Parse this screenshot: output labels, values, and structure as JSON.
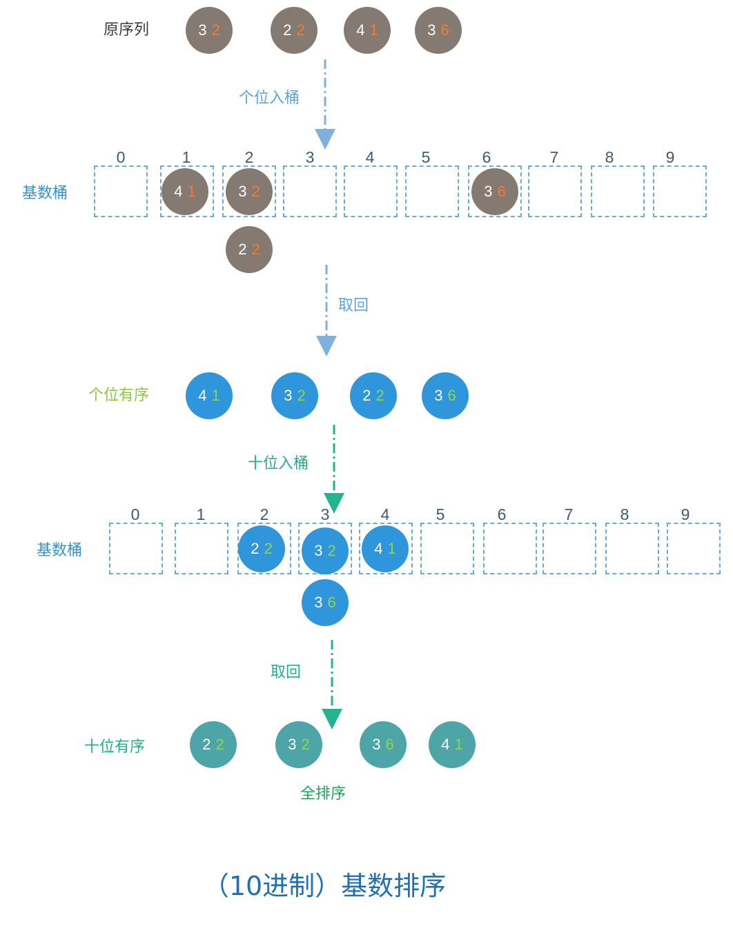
{
  "labels": {
    "original": "原序列",
    "ones_into_bucket": "个位入桶",
    "bucket1": "基数桶",
    "take_back1": "取回",
    "ones_sorted": "个位有序",
    "tens_into_bucket": "十位入桶",
    "bucket2": "基数桶",
    "take_back2": "取回",
    "tens_sorted": "十位有序",
    "fully_sorted": "全排序"
  },
  "title": "（10进制）基数排序",
  "bucket_indices": [
    "0",
    "1",
    "2",
    "3",
    "4",
    "5",
    "6",
    "7",
    "8",
    "9"
  ],
  "original_sequence": [
    {
      "tens": "3",
      "ones": "2"
    },
    {
      "tens": "2",
      "ones": "2"
    },
    {
      "tens": "4",
      "ones": "1"
    },
    {
      "tens": "3",
      "ones": "6"
    }
  ],
  "ones_buckets": [
    {
      "bucket": "1",
      "items": [
        {
          "tens": "4",
          "ones": "1"
        }
      ]
    },
    {
      "bucket": "2",
      "items": [
        {
          "tens": "3",
          "ones": "2"
        },
        {
          "tens": "2",
          "ones": "2"
        }
      ]
    },
    {
      "bucket": "6",
      "items": [
        {
          "tens": "3",
          "ones": "6"
        }
      ]
    }
  ],
  "ones_sorted_sequence": [
    {
      "tens": "4",
      "ones": "1"
    },
    {
      "tens": "3",
      "ones": "2"
    },
    {
      "tens": "2",
      "ones": "2"
    },
    {
      "tens": "3",
      "ones": "6"
    }
  ],
  "tens_buckets": [
    {
      "bucket": "2",
      "items": [
        {
          "tens": "2",
          "ones": "2"
        }
      ]
    },
    {
      "bucket": "3",
      "items": [
        {
          "tens": "3",
          "ones": "2"
        },
        {
          "tens": "3",
          "ones": "6"
        }
      ]
    },
    {
      "bucket": "4",
      "items": [
        {
          "tens": "4",
          "ones": "1"
        }
      ]
    }
  ],
  "tens_sorted_sequence": [
    {
      "tens": "2",
      "ones": "2"
    },
    {
      "tens": "3",
      "ones": "2"
    },
    {
      "tens": "3",
      "ones": "6"
    },
    {
      "tens": "4",
      "ones": "1"
    }
  ],
  "colors": {
    "gray_circle": "#857a72",
    "blue_circle": "#2f96dc",
    "teal_circle": "#4ea5a7",
    "orange_digit": "#f07d31",
    "green_digit": "#8ed64e",
    "bucket_border": "#6aa9dc",
    "arrow_blue": "#7fb0e0",
    "arrow_teal": "#22b48c",
    "title": "#1f6fb8"
  }
}
